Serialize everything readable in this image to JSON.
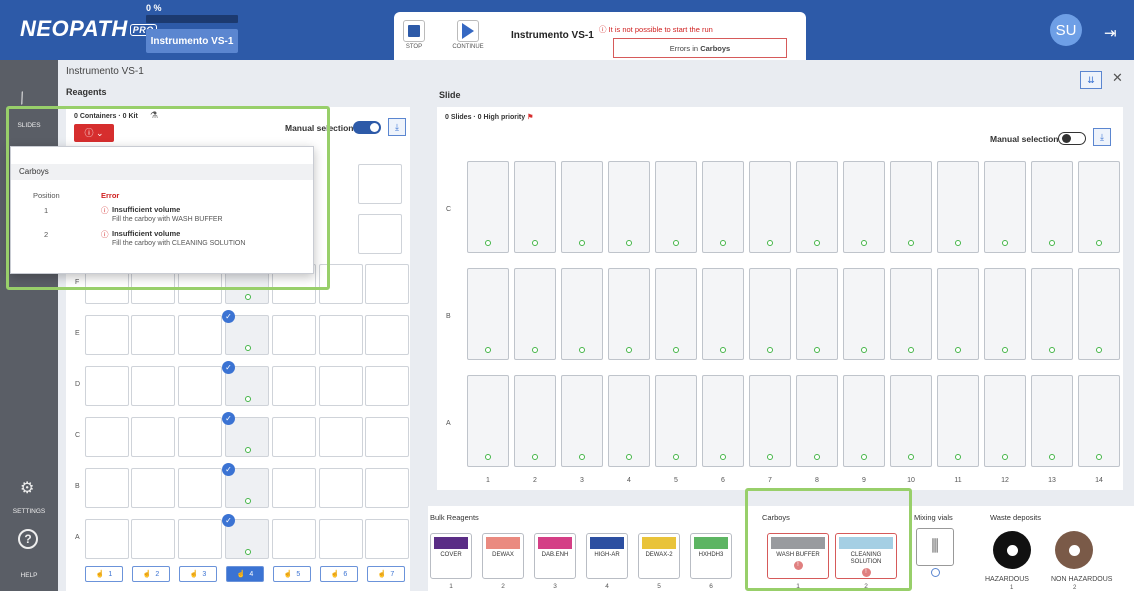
{
  "app": {
    "brand": "NEOPATH",
    "brand_suffix": "PRO",
    "progress_label": "0 %",
    "progress_fraction": 0.0,
    "instrument_button": "Instrumento VS-1"
  },
  "run": {
    "stop_label": "STOP",
    "continue_label": "CONTINUE",
    "instrument": "Instrumento VS-1",
    "error_title": "It is not possible to start the run",
    "error_detail_prefix": "Errors in",
    "error_detail_strong": "Carboys"
  },
  "user": {
    "initials": "SU"
  },
  "sidebar": {
    "slides": "SLIDES",
    "settings": "SETTINGS",
    "help": "HELP"
  },
  "header": {
    "instrument": "Instrumento VS-1"
  },
  "reagents": {
    "title": "Reagents",
    "summary": "0 Containers · 0 Kit",
    "manual_selection": "Manual selection",
    "rows": [
      "F",
      "E",
      "D",
      "C",
      "B",
      "A"
    ],
    "hands": [
      "1",
      "2",
      "3",
      "4",
      "5",
      "6",
      "7"
    ],
    "selected_hand": "4"
  },
  "popup": {
    "title": "Carboys",
    "col_position": "Position",
    "col_error": "Error",
    "items": [
      {
        "position": "1",
        "title": "Insufficient volume",
        "detail": "Fill the carboy with WASH BUFFER"
      },
      {
        "position": "2",
        "title": "Insufficient volume",
        "detail": "Fill the carboy with CLEANING SOLUTION"
      }
    ]
  },
  "slide": {
    "title": "Slide",
    "summary": "0 Slides · 0 High priority",
    "manual_selection": "Manual selection",
    "rows": [
      "C",
      "B",
      "A"
    ],
    "columns": [
      "1",
      "2",
      "3",
      "4",
      "5",
      "6",
      "7",
      "8",
      "9",
      "10",
      "11",
      "12",
      "13",
      "14"
    ]
  },
  "bulk": {
    "title": "Bulk Reagents",
    "items": [
      {
        "label": "COVER",
        "color": "#5a2d86",
        "num": "1"
      },
      {
        "label": "DEWAX",
        "color": "#ea8a80",
        "num": "2"
      },
      {
        "label": "DAB.ENH",
        "color": "#d43f86",
        "num": "3"
      },
      {
        "label": "HIGH-AR",
        "color": "#2c4fa1",
        "num": "4"
      },
      {
        "label": "DEWAX-2",
        "color": "#e9c33a",
        "num": "5"
      },
      {
        "label": "HXHDH3",
        "color": "#5db563",
        "num": "6"
      }
    ]
  },
  "carboys": {
    "title": "Carboys",
    "items": [
      {
        "label": "WASH BUFFER",
        "color": "#999b9f",
        "num": "1",
        "error_mark": "!"
      },
      {
        "label": "CLEANING SOLUTION",
        "color": "#a5cfe4",
        "num": "2",
        "error_mark": "!"
      }
    ]
  },
  "mixing": {
    "title": "Mixing vials"
  },
  "waste": {
    "title": "Waste deposits",
    "hazardous": "HAZARDOUS",
    "non_hazardous": "NON HAZARDOUS",
    "hazardous_num": "1",
    "non_hazardous_num": "2"
  }
}
